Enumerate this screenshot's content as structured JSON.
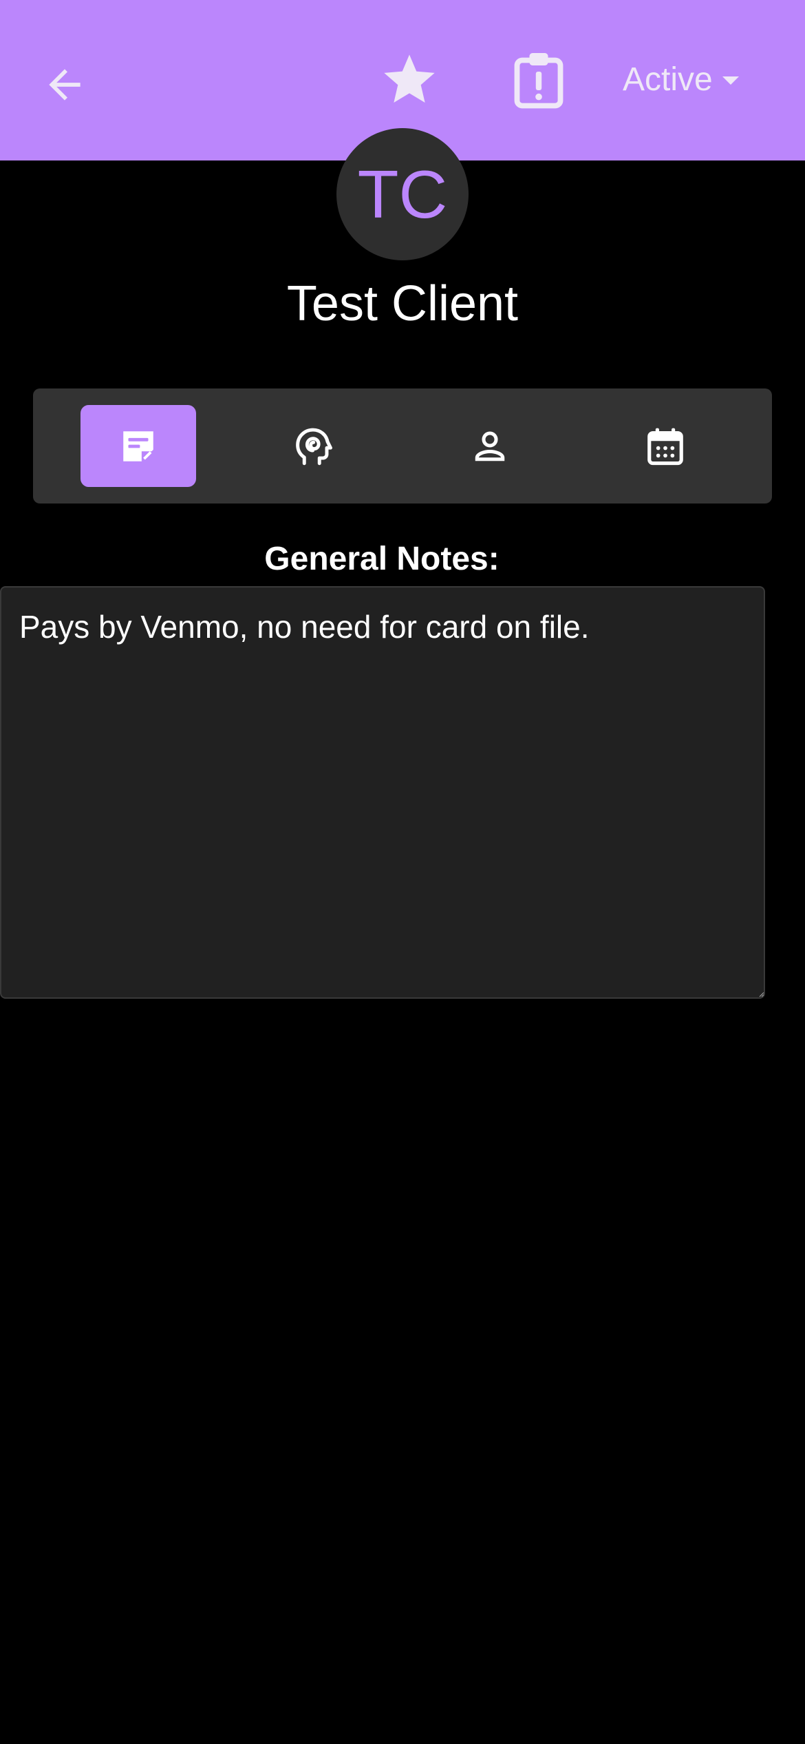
{
  "colors": {
    "accent": "#bb86fc",
    "background": "#000000",
    "surface": "#333333",
    "field": "#212121",
    "avatar_bg": "#2e2e2e"
  },
  "header": {
    "back_icon": "arrow-left-icon",
    "favorite_icon": "star-icon",
    "alert_icon": "clipboard-alert-icon",
    "status_value": "Active",
    "status_icon": "caret-down-icon"
  },
  "client": {
    "initials": "TC",
    "name": "Test Client"
  },
  "tabs": [
    {
      "icon": "note-icon",
      "active": true
    },
    {
      "icon": "mind-head-icon",
      "active": false
    },
    {
      "icon": "person-icon",
      "active": false
    },
    {
      "icon": "calendar-icon",
      "active": false
    }
  ],
  "notes": {
    "label": "General Notes:",
    "value": "Pays by Venmo, no need for card on file."
  }
}
